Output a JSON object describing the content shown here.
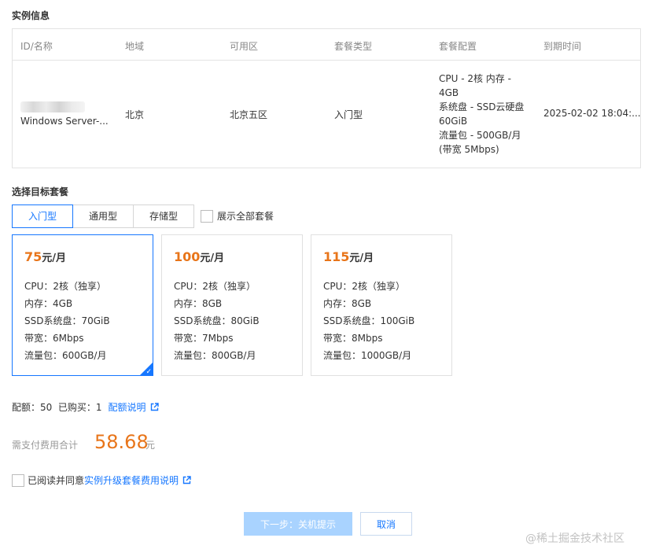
{
  "instance_section": {
    "title": "实例信息",
    "headers": [
      "ID/名称",
      "地域",
      "可用区",
      "套餐类型",
      "套餐配置",
      "到期时间"
    ],
    "row": {
      "name": "Windows Server-...",
      "region": "北京",
      "zone": "北京五区",
      "plan_type": "入门型",
      "config_lines": [
        "CPU - 2核 内存 -",
        "4GB",
        "系统盘 - SSD云硬盘",
        "60GiB",
        "流量包 - 500GB/月",
        "(带宽 5Mbps)"
      ],
      "expire": "2025-02-02 18:04:..."
    }
  },
  "target_section": {
    "title": "选择目标套餐",
    "tabs": [
      "入门型",
      "通用型",
      "存储型"
    ],
    "active_tab": "入门型",
    "show_all_label": "展示全部套餐",
    "show_all_checked": false
  },
  "plans": [
    {
      "price": "75",
      "unit": "元/月",
      "cpu": "CPU：2核（独享）",
      "memory": "内存：4GB",
      "disk": "SSD系统盘：70GiB",
      "bandwidth": "带宽：6Mbps",
      "traffic": "流量包：600GB/月",
      "selected": true
    },
    {
      "price": "100",
      "unit": "元/月",
      "cpu": "CPU：2核（独享）",
      "memory": "内存：8GB",
      "disk": "SSD系统盘：80GiB",
      "bandwidth": "带宽：7Mbps",
      "traffic": "流量包：800GB/月",
      "selected": false
    },
    {
      "price": "115",
      "unit": "元/月",
      "cpu": "CPU：2核（独享）",
      "memory": "内存：8GB",
      "disk": "SSD系统盘：100GiB",
      "bandwidth": "带宽：8Mbps",
      "traffic": "流量包：1000GB/月",
      "selected": false
    }
  ],
  "quota": {
    "text": "配额：50  已购买：1",
    "link": "配额说明",
    "icon": "external-link-icon"
  },
  "total": {
    "label": "需支付费用合计",
    "amount": "58.68",
    "unit": "元"
  },
  "agreement": {
    "text": "已阅读并同意",
    "link": "实例升级套餐费用说明",
    "checked": false,
    "icon": "external-link-icon"
  },
  "buttons": {
    "next": "下一步：关机提示",
    "cancel": "取消"
  },
  "watermark": "@稀土掘金技术社区",
  "colors": {
    "accent": "#1677ff",
    "price": "#e8751a",
    "next_disabled": "#a9d3ff"
  }
}
